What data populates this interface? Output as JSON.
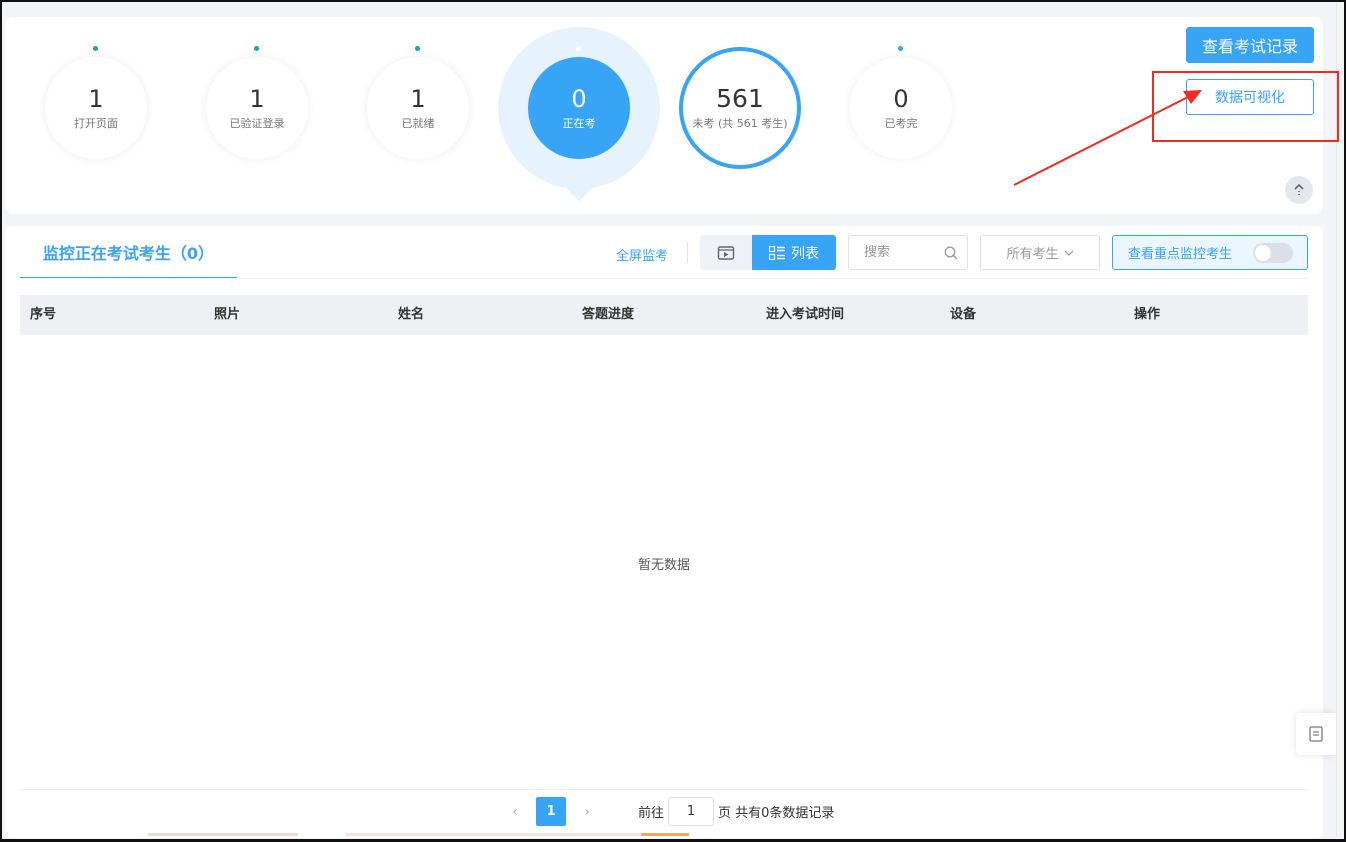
{
  "stats": [
    {
      "value": "1",
      "label": "打开页面"
    },
    {
      "value": "1",
      "label": "已验证登录"
    },
    {
      "value": "1",
      "label": "已就绪"
    },
    {
      "value": "0",
      "label": "正在考"
    },
    {
      "value": "561",
      "label": "未考 (共 561 考生)"
    },
    {
      "value": "0",
      "label": "已考完"
    }
  ],
  "buttons": {
    "view_records": "查看考试记录",
    "data_visual": "数据可视化"
  },
  "monitor": {
    "tab_title": "监控正在考试考生（0）",
    "fullscreen": "全屏监考",
    "list_view": "列表",
    "search_placeholder": "搜索",
    "filter_value": "所有考生",
    "focus_label": "查看重点监控考生"
  },
  "table": {
    "columns": [
      "序号",
      "照片",
      "姓名",
      "答题进度",
      "进入考试时间",
      "设备",
      "操作"
    ],
    "empty_text": "暂无数据"
  },
  "pagination": {
    "current_page": "1",
    "goto_label": "前往",
    "goto_value": "1",
    "summary": "页 共有0条数据记录"
  },
  "colors": {
    "accent": "#38a4f5",
    "annotation": "#f22a22"
  }
}
